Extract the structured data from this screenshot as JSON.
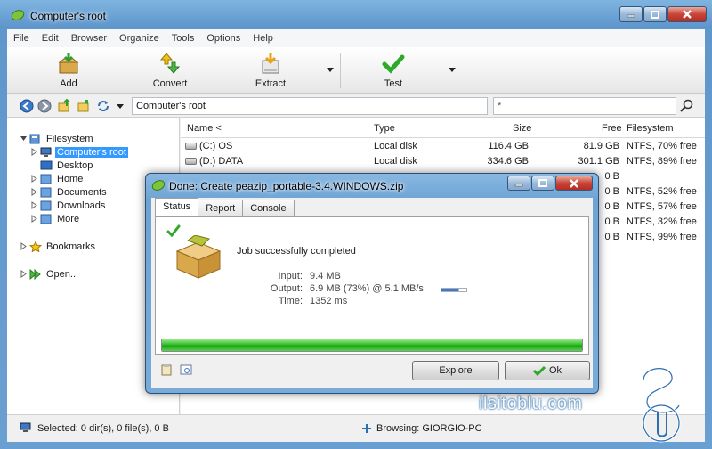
{
  "window": {
    "title": "Computer's root"
  },
  "menu": [
    "File",
    "Edit",
    "Browser",
    "Organize",
    "Tools",
    "Options",
    "Help"
  ],
  "toolbar": {
    "add": "Add",
    "convert": "Convert",
    "extract": "Extract",
    "test": "Test"
  },
  "address": {
    "path": "Computer's root",
    "filter": "*"
  },
  "tree": {
    "filesystem": "Filesystem",
    "computer_root": "Computer's root",
    "desktop": "Desktop",
    "home": "Home",
    "documents": "Documents",
    "downloads": "Downloads",
    "more": "More",
    "bookmarks": "Bookmarks",
    "open": "Open..."
  },
  "list": {
    "headers": {
      "name": "Name <",
      "type": "Type",
      "size": "Size",
      "free": "Free",
      "filesystem": "Filesystem"
    },
    "rows": [
      {
        "name": "(C:) OS",
        "type": "Local disk",
        "size": "116.4 GB",
        "free": "81.9 GB",
        "fs": "NTFS, 70% free"
      },
      {
        "name": "(D:) DATA",
        "type": "Local disk",
        "size": "334.6 GB",
        "free": "301.1 GB",
        "fs": "NTFS, 89% free"
      },
      {
        "name": "",
        "type": "",
        "size": "",
        "free": "0 B",
        "fs": ""
      },
      {
        "name": "",
        "type": "",
        "size": "",
        "free": "0 B",
        "fs": "NTFS, 52% free"
      },
      {
        "name": "",
        "type": "",
        "size": "",
        "free": "0 B",
        "fs": "NTFS, 57% free"
      },
      {
        "name": "",
        "type": "",
        "size": "",
        "free": "0 B",
        "fs": "NTFS, 32% free"
      },
      {
        "name": "",
        "type": "",
        "size": "",
        "free": "0 B",
        "fs": "NTFS, 99% free"
      }
    ]
  },
  "status": {
    "selected": "Selected: 0 dir(s), 0 file(s), 0 B",
    "browsing": "Browsing: GIORGIO-PC"
  },
  "dialog": {
    "title": "Done: Create peazip_portable-3.4.WINDOWS.zip",
    "tabs": [
      "Status",
      "Report",
      "Console"
    ],
    "message": "Job successfully completed",
    "input_label": "Input:",
    "input_value": "9.4 MB",
    "output_label": "Output:",
    "output_value": "6.9 MB (73%) @ 5.1 MB/s",
    "time_label": "Time:",
    "time_value": "1352 ms",
    "progress": 1.0,
    "explore": "Explore",
    "ok": "Ok"
  },
  "watermark": "ilsitoblu.com",
  "colors": {
    "accent": "#3399ff",
    "progress": "#2fbf28"
  }
}
